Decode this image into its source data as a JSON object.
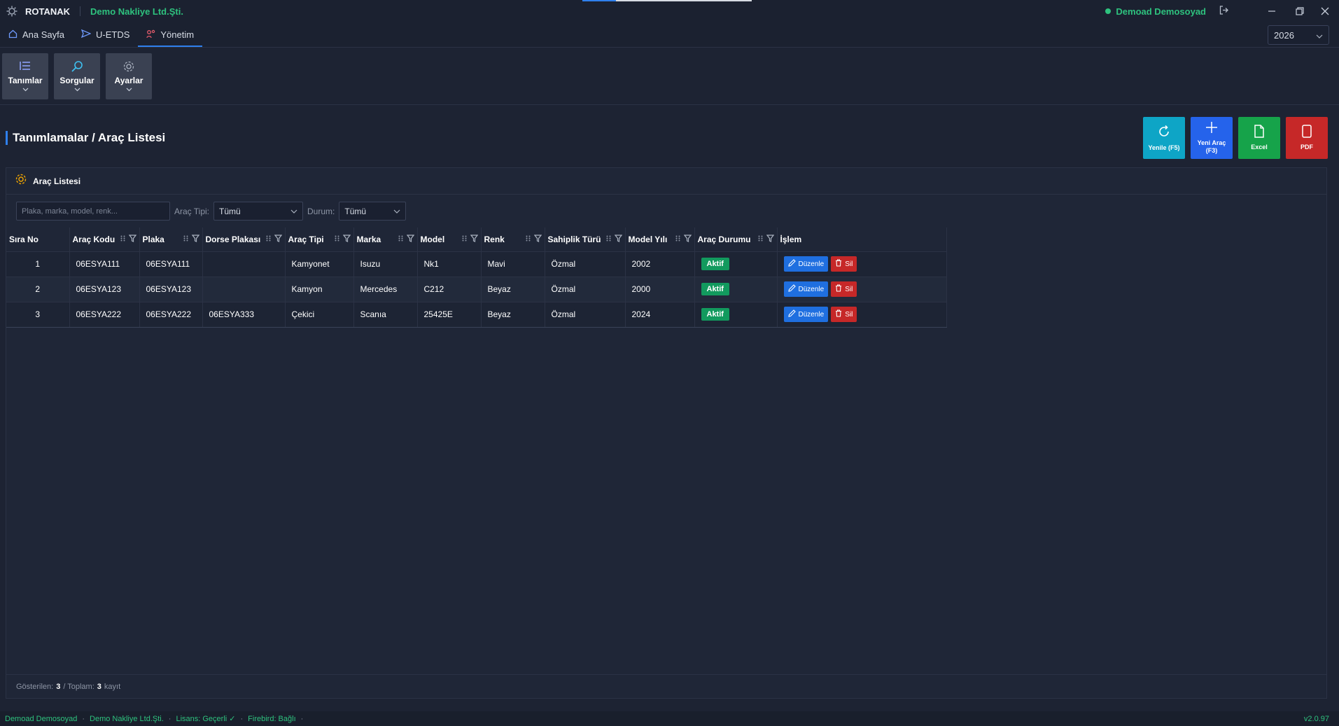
{
  "titlebar": {
    "app_name": "ROTANAK",
    "company": "Demo Nakliye Ltd.Şti.",
    "user": "Demoad Demosoyad",
    "loading_progress": 0.2
  },
  "nav": {
    "tabs": [
      {
        "label": "Ana Sayfa",
        "icon": "home-icon"
      },
      {
        "label": "U-ETDS",
        "icon": "send-icon"
      },
      {
        "label": "Yönetim",
        "icon": "admin-icon",
        "active": true
      }
    ],
    "year": "2026"
  },
  "ribbon": {
    "buttons": [
      {
        "label": "Tanımlar",
        "icon": "list-icon"
      },
      {
        "label": "Sorgular",
        "icon": "search-icon"
      },
      {
        "label": "Ayarlar",
        "icon": "gear-icon"
      }
    ]
  },
  "page": {
    "title": "Tanımlamalar / Araç Listesi"
  },
  "actions": {
    "refresh": "Yenile (F5)",
    "new_line1": "Yeni Araç",
    "new_line2": "(F3)",
    "excel": "Excel",
    "pdf": "PDF"
  },
  "colors": {
    "accent": "#2f80ed",
    "refresh": "#0ea5c6",
    "new": "#2563eb",
    "excel": "#16a34a",
    "pdf": "#c62828",
    "status_green": "#2ec27e"
  },
  "panel": {
    "title": "Araç Listesi",
    "search_placeholder": "Plaka, marka, model, renk...",
    "filter_type_label": "Araç Tipi:",
    "filter_type_value": "Tümü",
    "filter_status_label": "Durum:",
    "filter_status_value": "Tümü"
  },
  "table": {
    "columns": [
      "Sıra No",
      "Araç Kodu",
      "Plaka",
      "Dorse Plakası",
      "Araç Tipi",
      "Marka",
      "Model",
      "Renk",
      "Sahiplik Türü",
      "Model Yılı",
      "Araç Durumu",
      "İşlem"
    ],
    "rows": [
      [
        "1",
        "06ESYA111",
        "06ESYA111",
        "",
        "Kamyonet",
        "Isuzu",
        "Nk1",
        "Mavi",
        "Özmal",
        "2002",
        "Aktif"
      ],
      [
        "2",
        "06ESYA123",
        "06ESYA123",
        "",
        "Kamyon",
        "Mercedes",
        "C212",
        "Beyaz",
        "Özmal",
        "2000",
        "Aktif"
      ],
      [
        "3",
        "06ESYA222",
        "06ESYA222",
        "06ESYA333",
        "Çekici",
        "Scanıa",
        "25425E",
        "Beyaz",
        "Özmal",
        "2024",
        "Aktif"
      ]
    ],
    "edit_label": "Düzenle",
    "delete_label": "Sil"
  },
  "footer": {
    "shown_label": "Gösterilen:",
    "shown": "3",
    "total_label": "/ Toplam:",
    "total": "3",
    "unit": "kayıt"
  },
  "statusbar": {
    "user": "Demoad Demosoyad",
    "company": "Demo Nakliye Ltd.Şti.",
    "license": "Lisans: Geçerli ✓",
    "db": "Firebird: Bağlı",
    "version": "v2.0.97"
  }
}
